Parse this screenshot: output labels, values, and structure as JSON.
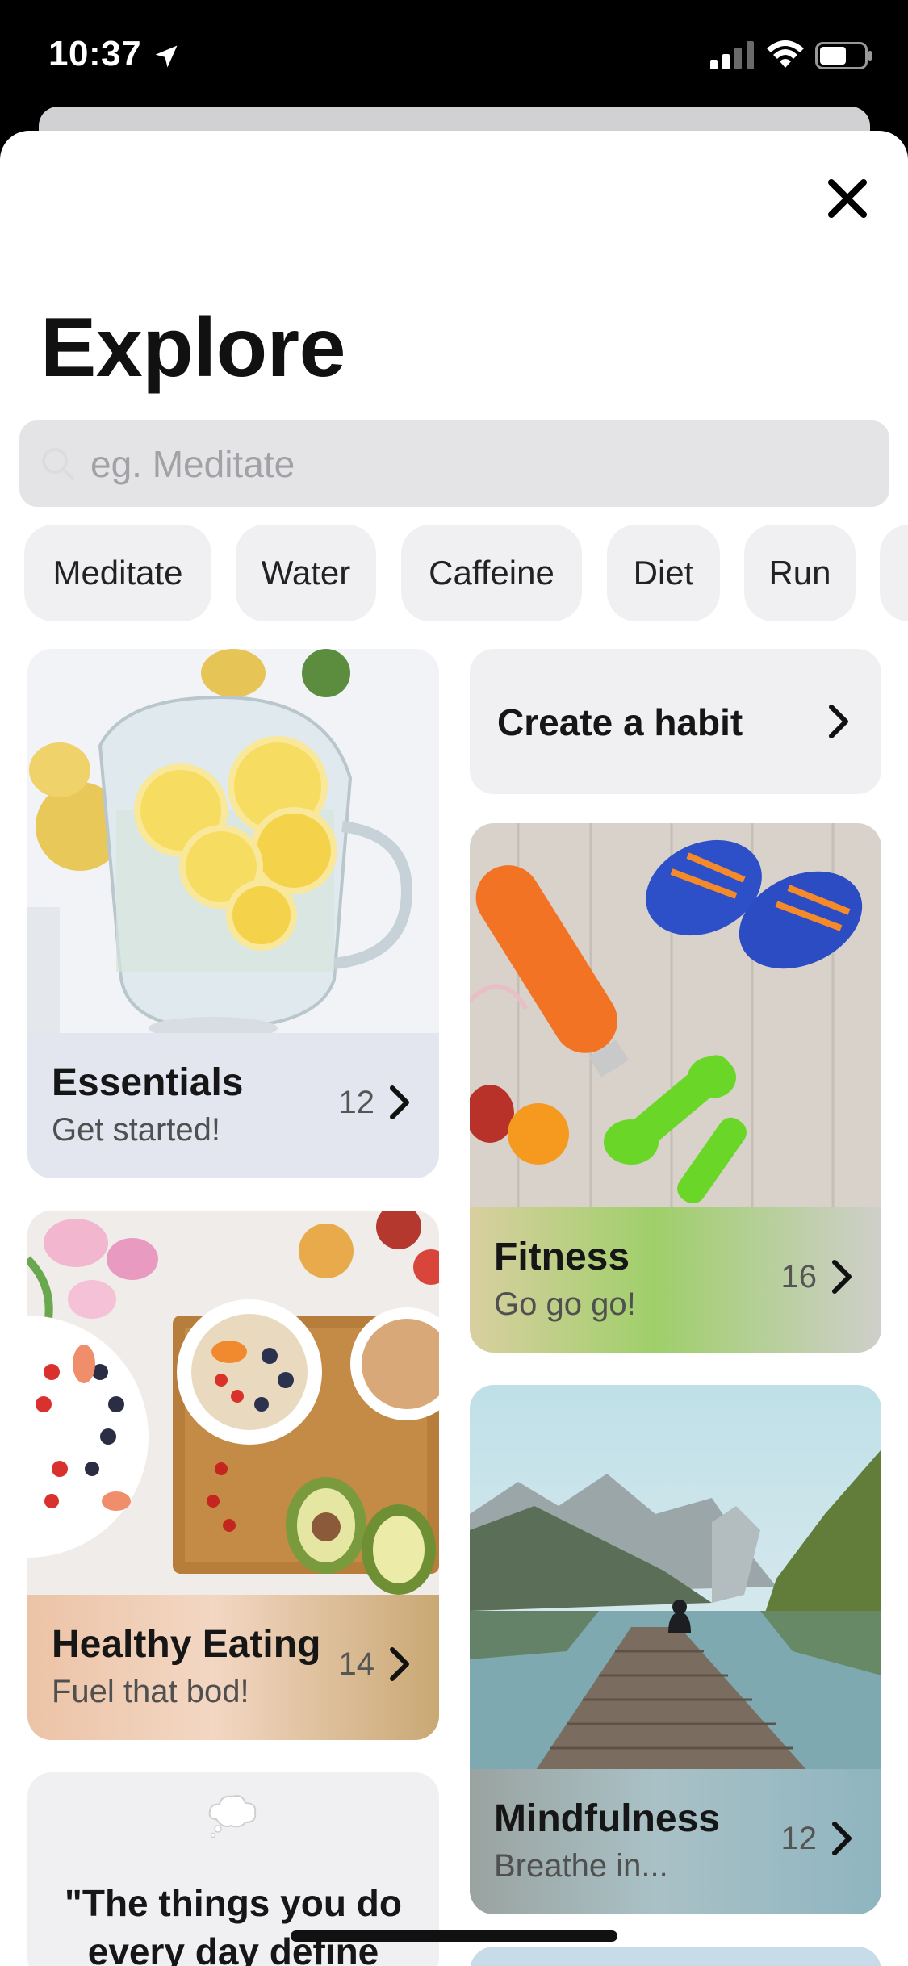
{
  "status_bar": {
    "time": "10:37"
  },
  "sheet": {
    "title": "Explore",
    "search": {
      "placeholder": "eg. Meditate"
    },
    "chips": [
      "Meditate",
      "Water",
      "Caffeine",
      "Diet",
      "Run"
    ],
    "create_habit": {
      "label": "Create a habit"
    },
    "cards": {
      "essentials": {
        "title": "Essentials",
        "subtitle": "Get started!",
        "count": "12"
      },
      "fitness": {
        "title": "Fitness",
        "subtitle": "Go go go!",
        "count": "16"
      },
      "healthy_eating": {
        "title": "Healthy Eating",
        "subtitle": "Fuel that bod!",
        "count": "14"
      },
      "mindfulness": {
        "title": "Mindfulness",
        "subtitle": "Breathe in...",
        "count": "12"
      }
    },
    "quote": {
      "text": "\"The things you do every day define"
    }
  },
  "icons": {
    "location": "location-arrow-icon",
    "signal": "cellular-signal-icon",
    "wifi": "wifi-icon",
    "battery": "battery-icon",
    "close": "close-icon",
    "search": "search-icon",
    "chevron": "chevron-right-icon",
    "thought": "thought-bubble-icon"
  },
  "colors": {
    "essentials_footer": "#e3e6ee",
    "fitness_gradient": [
      "#d9cfa0",
      "#9fcf6a",
      "#cfcfca"
    ],
    "healthy_eating_gradient": [
      "#ecc3a6",
      "#f3d7c3",
      "#c9a874"
    ],
    "mindfulness_gradient": [
      "#9aa3a0",
      "#a9c1c6",
      "#8fb5c0"
    ]
  }
}
